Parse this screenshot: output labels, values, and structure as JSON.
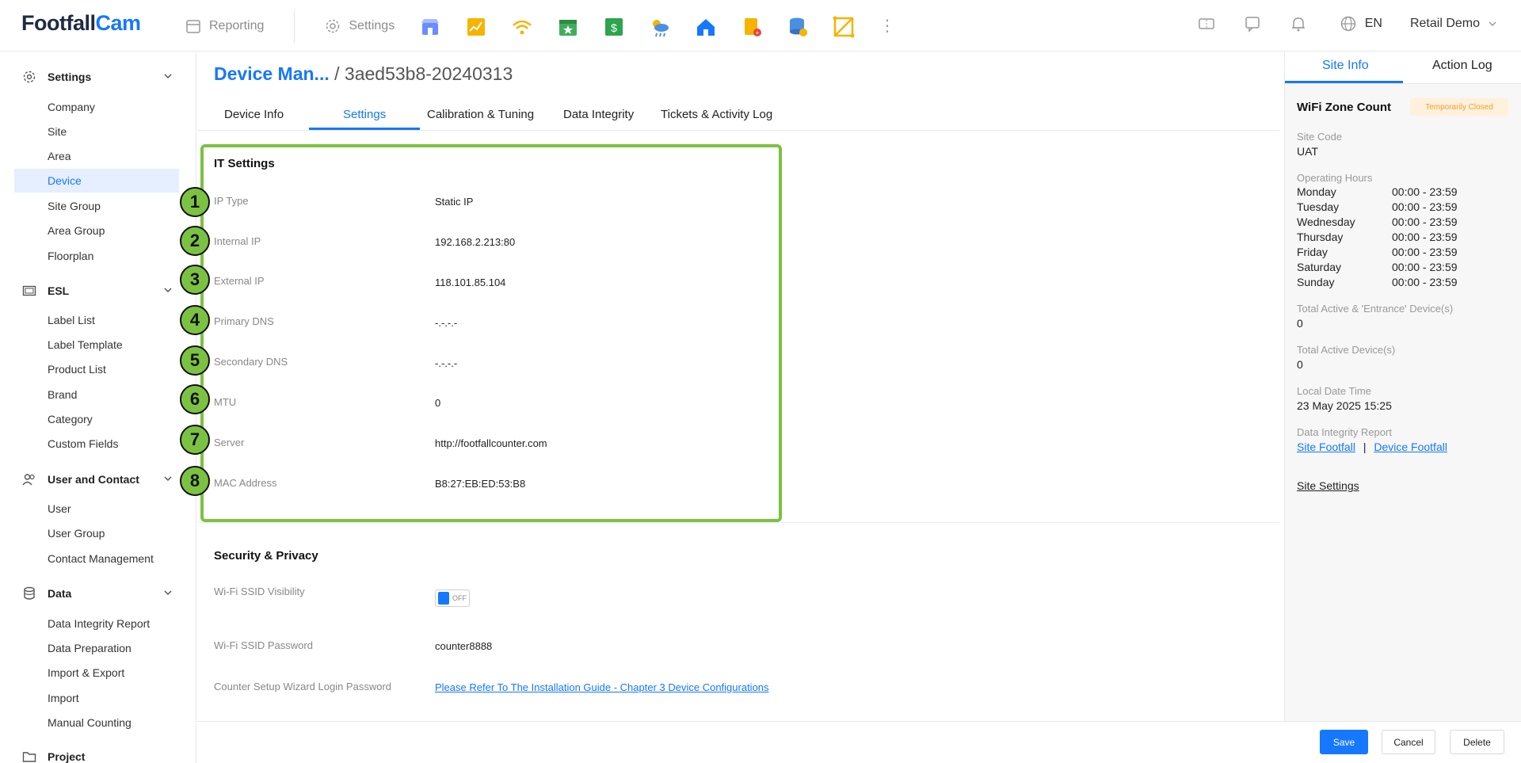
{
  "brand": {
    "part1": "Footfall",
    "part2": "Cam"
  },
  "topnav": {
    "reporting": "Reporting",
    "settings": "Settings",
    "more": "⋮"
  },
  "top_right": {
    "lang": "EN",
    "account": "Retail Demo"
  },
  "sidebar": {
    "settings": {
      "title": "Settings",
      "items": [
        "Company",
        "Site",
        "Area",
        "Device",
        "Site Group",
        "Area Group",
        "Floorplan"
      ]
    },
    "esl": {
      "title": "ESL",
      "items": [
        "Label List",
        "Label Template",
        "Product List",
        "Brand",
        "Category",
        "Custom Fields"
      ]
    },
    "user": {
      "title": "User and Contact",
      "items": [
        "User",
        "User Group",
        "Contact Management"
      ]
    },
    "data": {
      "title": "Data",
      "items": [
        "Data Integrity Report",
        "Data Preparation",
        "Import & Export",
        "Import",
        "Manual Counting"
      ]
    },
    "project": {
      "title": "Project"
    }
  },
  "breadcrumb": {
    "root": "Device Man...",
    "separator": " / ",
    "current": "3aed53b8-20240313"
  },
  "tabs": [
    "Device Info",
    "Settings",
    "Calibration & Tuning",
    "Data Integrity",
    "Tickets & Activity Log"
  ],
  "it_settings": {
    "title": "IT Settings",
    "rows": [
      {
        "num": "1",
        "label": "IP Type",
        "value": "Static IP"
      },
      {
        "num": "2",
        "label": "Internal IP",
        "value": "192.168.2.213:80"
      },
      {
        "num": "3",
        "label": "External IP",
        "value": "118.101.85.104"
      },
      {
        "num": "4",
        "label": "Primary DNS",
        "value": "-.-.-.-"
      },
      {
        "num": "5",
        "label": "Secondary DNS",
        "value": "-.-.-.-"
      },
      {
        "num": "6",
        "label": "MTU",
        "value": "0"
      },
      {
        "num": "7",
        "label": "Server",
        "value": "http://footfallcounter.com"
      },
      {
        "num": "8",
        "label": "MAC Address",
        "value": "B8:27:EB:ED:53:B8"
      }
    ]
  },
  "security": {
    "title": "Security & Privacy",
    "ssid_visibility_label": "Wi-Fi SSID Visibility",
    "ssid_visibility_state": "OFF",
    "ssid_password_label": "Wi-Fi SSID Password",
    "ssid_password_value": "counter8888",
    "wizard_label": "Counter Setup Wizard Login Password",
    "wizard_link": "Please Refer To The Installation Guide - Chapter 3 Device Configurations"
  },
  "right_panel": {
    "tabs": [
      "Site Info",
      "Action Log"
    ],
    "title": "WiFi Zone Count",
    "status_badge": "Temporarily Closed",
    "site_code_label": "Site Code",
    "site_code": "UAT",
    "operating_hours_label": "Operating Hours",
    "hours": [
      {
        "day": "Monday",
        "time": "00:00 - 23:59"
      },
      {
        "day": "Tuesday",
        "time": "00:00 - 23:59"
      },
      {
        "day": "Wednesday",
        "time": "00:00 - 23:59"
      },
      {
        "day": "Thursday",
        "time": "00:00 - 23:59"
      },
      {
        "day": "Friday",
        "time": "00:00 - 23:59"
      },
      {
        "day": "Saturday",
        "time": "00:00 - 23:59"
      },
      {
        "day": "Sunday",
        "time": "00:00 - 23:59"
      }
    ],
    "entrance_label": "Total Active & 'Entrance' Device(s)",
    "entrance_value": "0",
    "active_label": "Total Active Device(s)",
    "active_value": "0",
    "local_time_label": "Local Date Time",
    "local_time": "23 May 2025 15:25",
    "integrity_label": "Data Integrity Report",
    "site_footfall": "Site Footfall",
    "pipe": "|",
    "device_footfall": "Device Footfall",
    "site_settings": "Site Settings"
  },
  "footer": {
    "save": "Save",
    "cancel": "Cancel",
    "delete": "Delete"
  },
  "colors": {
    "accent": "#1677ff",
    "highlight_border": "#7cc242",
    "badge_bg": "#fff1dc",
    "badge_text": "#f0a030"
  }
}
